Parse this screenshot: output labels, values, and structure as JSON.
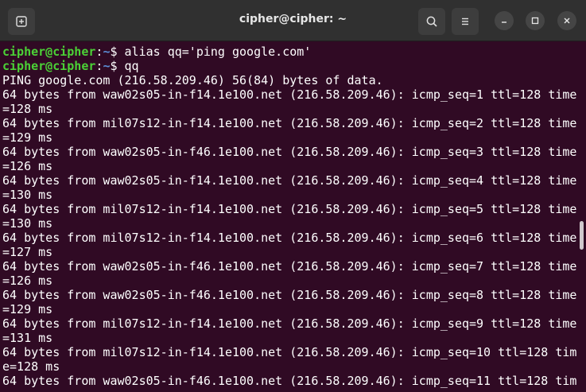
{
  "window": {
    "title": "cipher@cipher: ~"
  },
  "prompt": {
    "user_host": "cipher@cipher",
    "colon": ":",
    "path": "~",
    "symbol": "$ "
  },
  "commands": [
    "alias qq='ping google.com'",
    "qq"
  ],
  "output": [
    "PING google.com (216.58.209.46) 56(84) bytes of data.",
    "64 bytes from waw02s05-in-f14.1e100.net (216.58.209.46): icmp_seq=1 ttl=128 time",
    "=128 ms",
    "64 bytes from mil07s12-in-f14.1e100.net (216.58.209.46): icmp_seq=2 ttl=128 time",
    "=129 ms",
    "64 bytes from waw02s05-in-f46.1e100.net (216.58.209.46): icmp_seq=3 ttl=128 time",
    "=126 ms",
    "64 bytes from waw02s05-in-f14.1e100.net (216.58.209.46): icmp_seq=4 ttl=128 time",
    "=130 ms",
    "64 bytes from mil07s12-in-f14.1e100.net (216.58.209.46): icmp_seq=5 ttl=128 time",
    "=130 ms",
    "64 bytes from mil07s12-in-f14.1e100.net (216.58.209.46): icmp_seq=6 ttl=128 time",
    "=127 ms",
    "64 bytes from waw02s05-in-f46.1e100.net (216.58.209.46): icmp_seq=7 ttl=128 time",
    "=126 ms",
    "64 bytes from waw02s05-in-f46.1e100.net (216.58.209.46): icmp_seq=8 ttl=128 time",
    "=129 ms",
    "64 bytes from mil07s12-in-f14.1e100.net (216.58.209.46): icmp_seq=9 ttl=128 time",
    "=131 ms",
    "64 bytes from mil07s12-in-f14.1e100.net (216.58.209.46): icmp_seq=10 ttl=128 tim",
    "e=128 ms",
    "64 bytes from waw02s05-in-f46.1e100.net (216.58.209.46): icmp_seq=11 ttl=128 tim"
  ],
  "icons": {
    "new_tab": "new-tab-icon",
    "search": "search-icon",
    "menu": "hamburger-menu-icon",
    "minimize": "minimize-icon",
    "maximize": "maximize-icon",
    "close": "close-icon"
  },
  "colors": {
    "terminal_bg": "#300a24",
    "prompt_user": "#4bd136",
    "prompt_path": "#5b8fd8",
    "text": "#ffffff"
  }
}
